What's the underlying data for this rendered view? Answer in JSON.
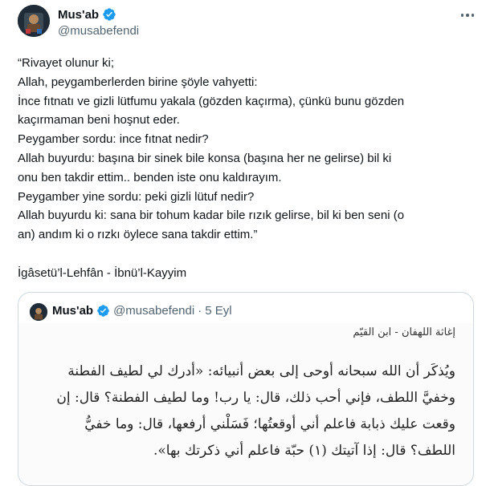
{
  "tweet": {
    "author_name": "Mus'ab",
    "handle": "@musabefendi",
    "lines": [
      "“Rivayet olunur ki;",
      "Allah, peygamberlerden birine şöyle vahyetti:",
      "İnce fıtnatı ve gizli lütfumu yakala (gözden kaçırma), çünkü bunu gözden",
      "kaçırmaman beni hoşnut eder.",
      "Peygamber sordu: ince fıtnat nedir?",
      "Allah buyurdu: başına bir sinek bile konsa (başına her ne gelirse) bil ki",
      "onu ben takdir ettim.. benden iste onu kaldırayım.",
      "Peygamber yine sordu: peki gizli lütuf nedir?",
      "Allah buyurdu ki: sana bir tohum kadar bile rızık gelirse, bil ki ben seni (o",
      "an) andım ki o rızkı öylece sana takdir ettim.”"
    ],
    "source": "İgâsetü’l-Lehfân - İbnü’l-Kayyim"
  },
  "quote": {
    "author_name": "Mus'ab",
    "handle": "@musabefendi",
    "separator": "·",
    "date": "5 Eyl",
    "image_title": "إغاثة اللهفان - ابن القيّم",
    "image_lines": [
      "ويُذكَر أن الله سبحانه أوحى إلى بعض أنبيائه: «أدرك لي لطيف الفطنة",
      "وخفيَّ اللطف، فإني أحب ذلك، قال: يا رب! وما لطيف الفطنة؟ قال: إن",
      "وقعت عليك ذبابة فاعلم أني أوقعتُها؛ فَسَلْني أرفعها، قال: وما خفيُّ",
      "اللطف؟ قال: إذا آتيتك (١) حبّة فاعلم أني ذكرتك بها»."
    ]
  },
  "colors": {
    "text": "#0f1419",
    "muted": "#536471",
    "verified": "#1d9bf0",
    "border": "#cfd9de"
  }
}
